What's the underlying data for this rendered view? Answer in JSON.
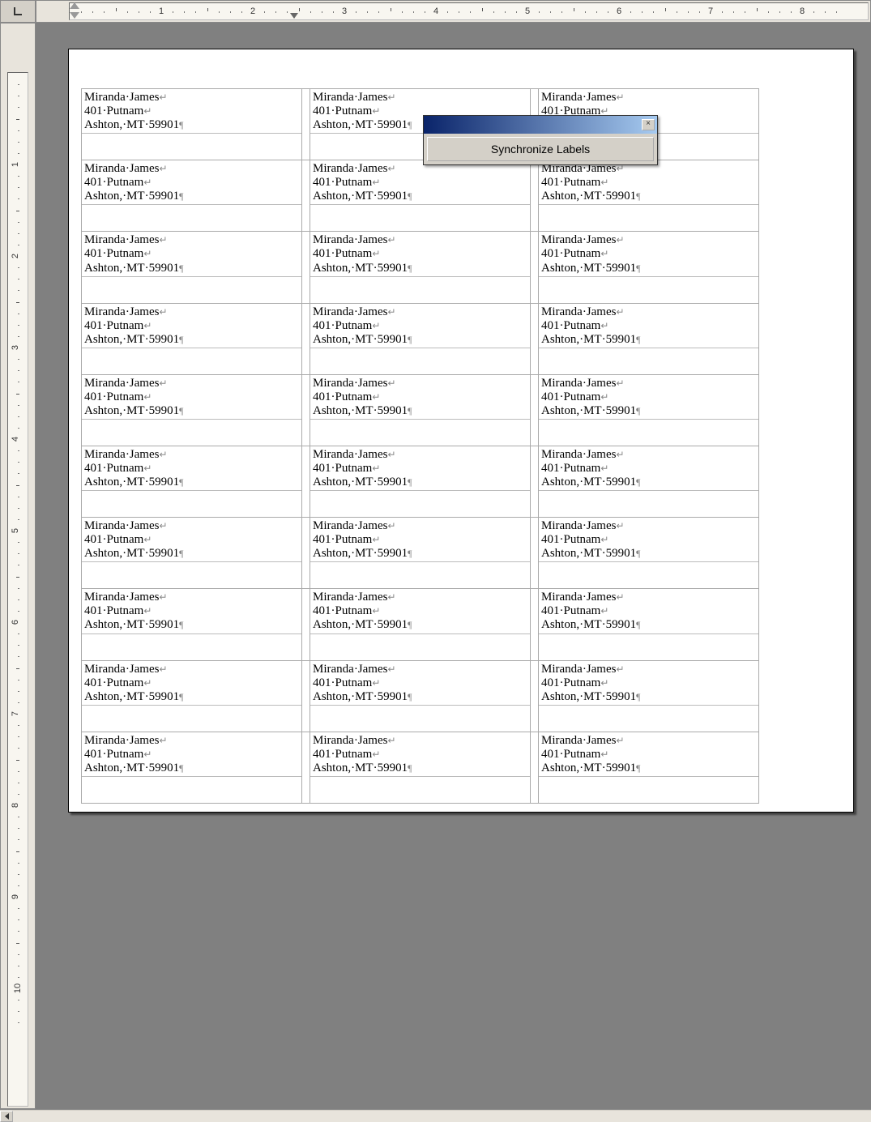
{
  "ruler": {
    "h_numbers": [
      "1",
      "2",
      "3",
      "4",
      "5",
      "6",
      "7",
      "8"
    ],
    "v_numbers": [
      "1",
      "2",
      "3",
      "4",
      "5",
      "6",
      "7",
      "8",
      "9",
      "10"
    ]
  },
  "toolbar": {
    "sync_label": "Synchronize Labels",
    "close_label": "×"
  },
  "label": {
    "line1": "Miranda·James",
    "line2": "401·Putnam",
    "line3": "Ashton,·MT·59901",
    "ret": "↵",
    "pilcrow": "¶"
  },
  "grid": {
    "rows": 10,
    "cols": 3
  }
}
